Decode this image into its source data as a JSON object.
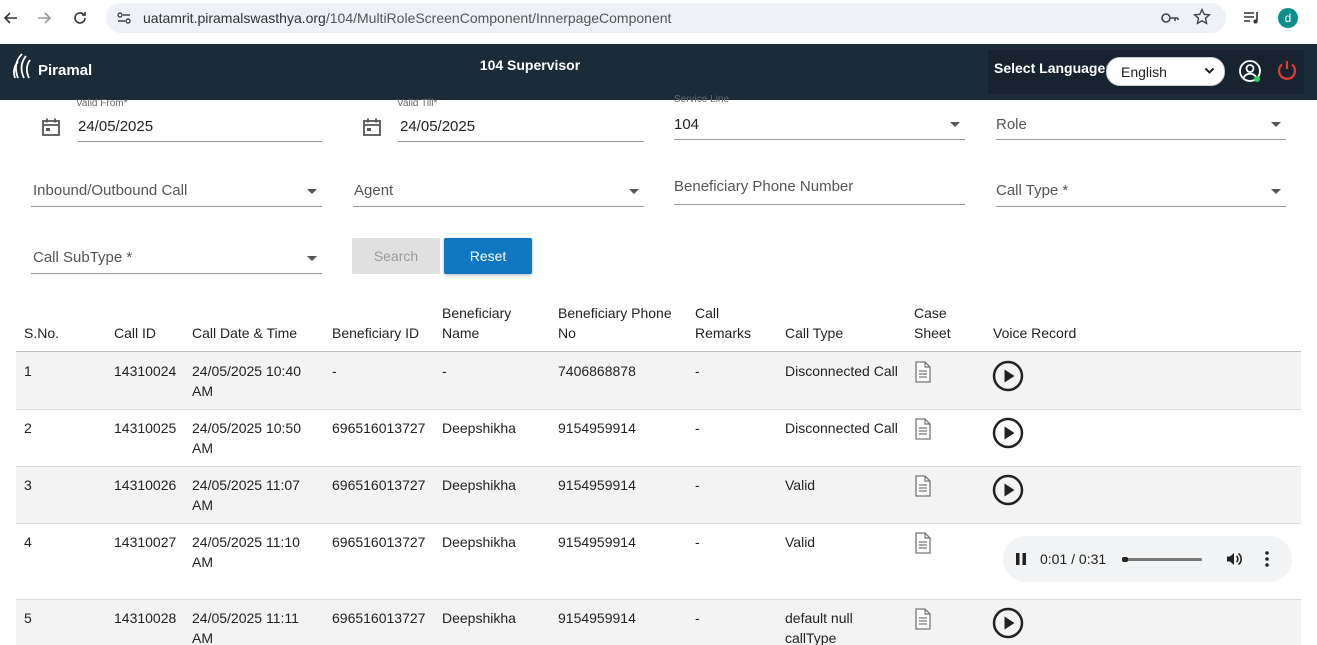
{
  "browser": {
    "url_host": "uatamrit.piramalswasthya.org",
    "url_path": "/104/MultiRoleScreenComponent/InnerpageComponent",
    "profile_initial": "d"
  },
  "header": {
    "logo_text": "Piramal",
    "title": "104 Supervisor",
    "language_label": "Select Language:",
    "language_value": "English"
  },
  "form": {
    "valid_from_label": "Valid From*",
    "valid_from_value": "24/05/2025",
    "valid_till_label": "Valid Till*",
    "valid_till_value": "24/05/2025",
    "service_line_label": "Service Line",
    "service_line_value": "104",
    "role_placeholder": "Role",
    "inbound_outbound_placeholder": "Inbound/Outbound Call",
    "agent_placeholder": "Agent",
    "beneficiary_phone_placeholder": "Beneficiary Phone Number",
    "call_type_placeholder": "Call Type *",
    "call_subtype_placeholder": "Call SubType *",
    "search_label": "Search",
    "reset_label": "Reset"
  },
  "table": {
    "headers": {
      "sno": "S.No.",
      "call_id": "Call ID",
      "call_date_time": "Call Date & Time",
      "beneficiary_id": "Beneficiary ID",
      "beneficiary_name_1": "Beneficiary",
      "beneficiary_name_2": "Name",
      "beneficiary_phone_1": "Beneficiary Phone",
      "beneficiary_phone_2": "No",
      "call_remarks_1": "Call",
      "call_remarks_2": "Remarks",
      "call_type": "Call Type",
      "case_sheet_1": "Case",
      "case_sheet_2": "Sheet",
      "voice_record": "Voice Record"
    },
    "rows": [
      {
        "sno": "1",
        "call_id": "14310024",
        "date_1": "24/05/2025 10:40",
        "date_2": "AM",
        "ben_id": "-",
        "ben_name": "-",
        "phone": "7406868878",
        "remarks": "-",
        "call_type_1": "Disconnected Call",
        "call_type_2": ""
      },
      {
        "sno": "2",
        "call_id": "14310025",
        "date_1": "24/05/2025 10:50",
        "date_2": "AM",
        "ben_id": "696516013727",
        "ben_name": "Deepshikha",
        "phone": "9154959914",
        "remarks": "-",
        "call_type_1": "Disconnected Call",
        "call_type_2": ""
      },
      {
        "sno": "3",
        "call_id": "14310026",
        "date_1": "24/05/2025 11:07",
        "date_2": "AM",
        "ben_id": "696516013727",
        "ben_name": "Deepshikha",
        "phone": "9154959914",
        "remarks": "-",
        "call_type_1": "Valid",
        "call_type_2": ""
      },
      {
        "sno": "4",
        "call_id": "14310027",
        "date_1": "24/05/2025 11:10",
        "date_2": "AM",
        "ben_id": "696516013727",
        "ben_name": "Deepshikha",
        "phone": "9154959914",
        "remarks": "-",
        "call_type_1": "Valid",
        "call_type_2": ""
      },
      {
        "sno": "5",
        "call_id": "14310028",
        "date_1": "24/05/2025 11:11",
        "date_2": "AM",
        "ben_id": "696516013727",
        "ben_name": "Deepshikha",
        "phone": "9154959914",
        "remarks": "-",
        "call_type_1": "default null",
        "call_type_2": "callType"
      }
    ],
    "audio": {
      "time": "0:01 / 0:31",
      "progress": 0.03
    }
  },
  "colors": {
    "header_bg": "#1c2b38",
    "reset_button": "#0d77c2",
    "power_icon": "#e53935",
    "online_dot": "#2ecc71"
  },
  "icons": [
    "back-arrow-icon",
    "forward-arrow-icon",
    "reload-icon",
    "site-settings-icon",
    "key-icon",
    "star-icon",
    "media-control-icon",
    "calendar-icon",
    "dropdown-arrow-icon",
    "document-icon",
    "play-icon",
    "pause-icon",
    "volume-icon",
    "more-vert-icon",
    "user-account-icon",
    "power-icon"
  ]
}
